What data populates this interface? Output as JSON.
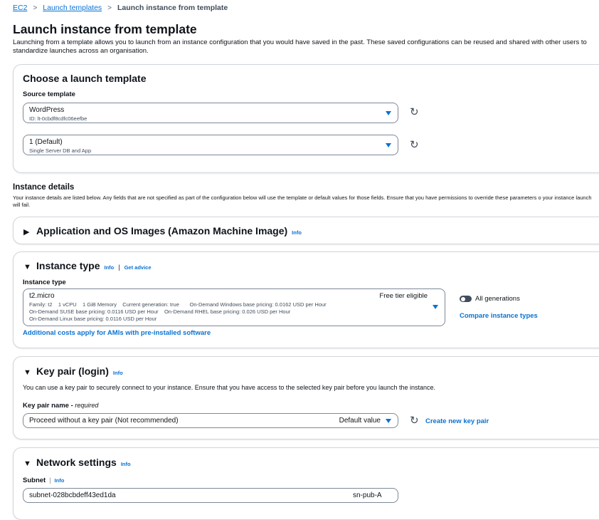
{
  "breadcrumb": {
    "ec2": "EC2",
    "templates": "Launch templates",
    "current": "Launch instance from template"
  },
  "page": {
    "title": "Launch instance from template",
    "description": "Launching from a template allows you to launch from an instance configuration that you would have saved in the past. These saved configurations can be reused and shared with other users to standardize launches across an organisation."
  },
  "choose_template": {
    "title": "Choose a launch template",
    "source_label": "Source template",
    "template": {
      "value": "WordPress",
      "sub": "ID: lt-0cbdf8cdfc06eefbe"
    },
    "version": {
      "value": "1 (Default)",
      "sub": "Single Server DB and App"
    }
  },
  "instance_details": {
    "title": "Instance details",
    "description": "Your instance details are listed below. Any fields that are not specified as part of the configuration below will use the template or default values for those fields. Ensure that you have permissions to override these parameters o your instance launch will fail."
  },
  "ami_section": {
    "title": "Application and OS Images (Amazon Machine Image)",
    "info": "Info"
  },
  "instance_type": {
    "title": "Instance type",
    "info": "Info",
    "separator": "|",
    "advice": "Get advice",
    "label": "Instance type",
    "value": "t2.micro",
    "badge": "Free tier eligible",
    "line1": "Family: t2    1 vCPU    1 GiB Memory    Current generation: true       On-Demand Windows base pricing: 0.0162 USD per Hour",
    "line2": "On-Demand SUSE base pricing: 0.0116 USD per Hour    On-Demand RHEL base pricing: 0.026 USD per Hour",
    "line3": "On-Demand Linux base pricing: 0.0116 USD per Hour",
    "all_generations": "All generations",
    "compare": "Compare instance types",
    "additional_costs": "Additional costs apply for AMIs with pre-installed software"
  },
  "key_pair": {
    "title": "Key pair (login)",
    "info": "Info",
    "description": "You can use a key pair to securely connect to your instance. Ensure that you have access to the selected key pair before you launch the instance.",
    "label": "Key pair name",
    "required": "required",
    "value": "Proceed without a key pair (Not recommended)",
    "default_value": "Default value",
    "create": "Create new key pair"
  },
  "network": {
    "title": "Network settings",
    "info": "Info",
    "subnet_label": "Subnet",
    "subnet_info": "Info",
    "subnet_value": "subnet-028bcbdeff43ed1da",
    "subnet_name": "sn-pub-A"
  },
  "icons": {
    "refresh": "refresh-icon",
    "caret": "caret-down-icon",
    "expand": "triangle-right-icon",
    "collapse": "triangle-down-icon"
  },
  "colors": {
    "link": "#0972d3",
    "border": "#7d8998",
    "text": "#0f141a"
  }
}
